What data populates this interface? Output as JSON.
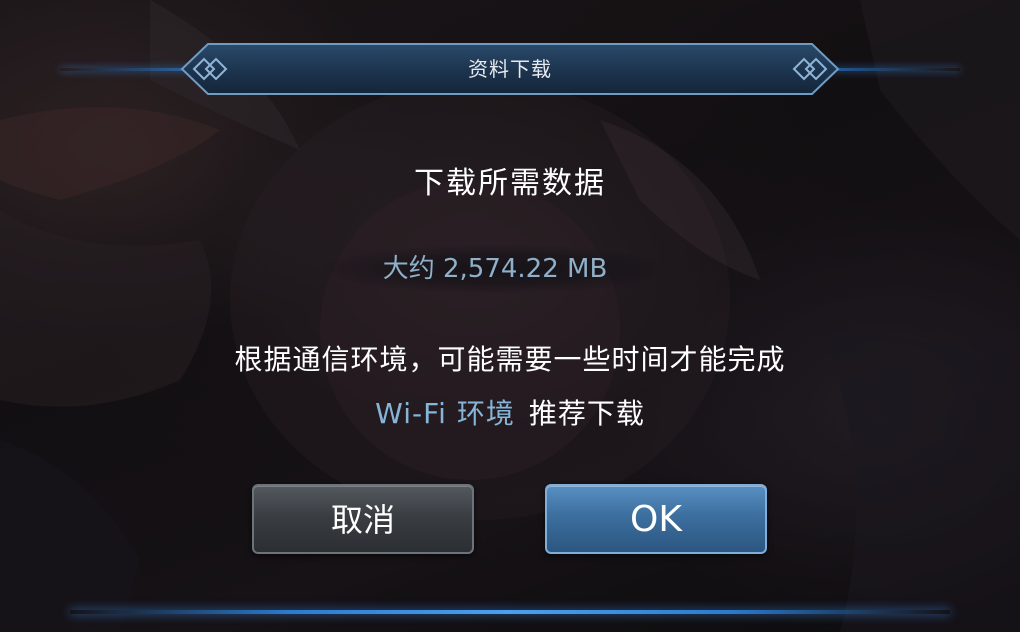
{
  "dialog": {
    "header_title": "资料下载",
    "main_title": "下载所需数据",
    "size_text": "大约 2,574.22 MB",
    "note_line1": "根据通信环境，可能需要一些时间才能完成",
    "wifi_text": "Wi-Fi 环境",
    "recommend_text": "推荐下载"
  },
  "buttons": {
    "cancel_label": "取消",
    "ok_label": "OK"
  },
  "icons": {
    "header_left": "diamond-ornament-icon",
    "header_right": "diamond-ornament-icon"
  },
  "colors": {
    "accent_blue": "#2a7bd0",
    "header_plate": "#1d3550",
    "wifi_text": "#86b5d8",
    "size_text": "#8fb0c8",
    "ok_button": "#3c6f9f",
    "cancel_button": "#3a3e43"
  }
}
